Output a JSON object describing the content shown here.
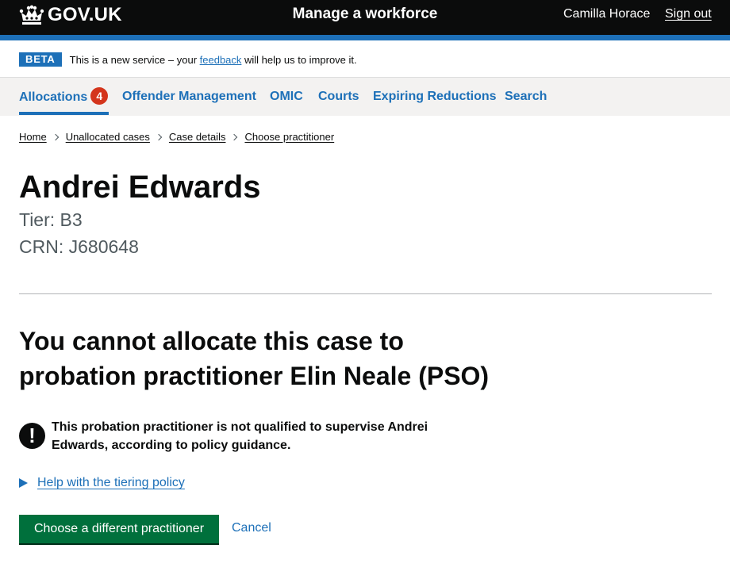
{
  "header": {
    "logo_text": "GOV.UK",
    "service_name": "Manage a workforce",
    "user_name": "Camilla Horace",
    "sign_out": "Sign out"
  },
  "phase_banner": {
    "tag": "BETA",
    "text_before": "This is a new service – your ",
    "link": "feedback",
    "text_after": " will help us to improve it."
  },
  "nav": {
    "items": [
      {
        "label": "Allocations",
        "badge": "4",
        "active": true
      },
      {
        "label": "Offender Management"
      },
      {
        "label": "OMIC"
      },
      {
        "label": "Courts"
      },
      {
        "label": "Expiring Reductions"
      },
      {
        "label": "Search"
      }
    ]
  },
  "breadcrumbs": [
    "Home",
    "Unallocated cases",
    "Case details",
    "Choose practitioner"
  ],
  "person": {
    "name": "Andrei Edwards",
    "tier": "Tier: B3",
    "crn": "CRN: J680648"
  },
  "main": {
    "heading": "You cannot allocate this case to probation practitioner Elin Neale (PSO)",
    "warning_icon": "!",
    "warning_text": "This probation practitioner is not qualified to supervise Andrei Edwards, according to policy guidance.",
    "details_summary": "Help with the tiering policy",
    "primary_button": "Choose a different practitioner",
    "cancel_link": "Cancel"
  },
  "colors": {
    "header_bg": "#0b0c0c",
    "brand_blue": "#1d70b8",
    "nav_bg": "#f3f2f1",
    "badge_red": "#d4351c",
    "button_green": "#00703c"
  }
}
